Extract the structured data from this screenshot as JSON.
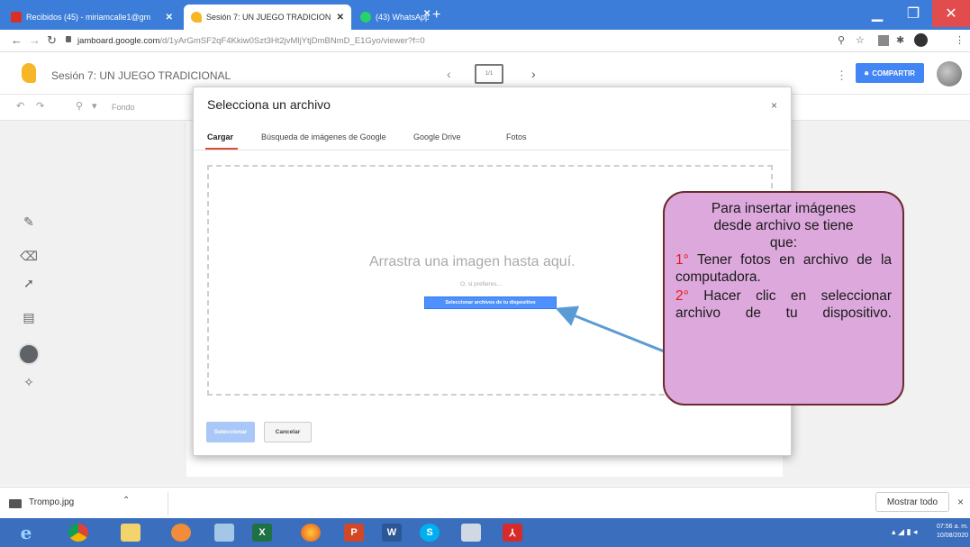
{
  "browser": {
    "tabs": [
      {
        "title": "Recibidos (45) - miriamcalle1@gm",
        "active": false,
        "favicon_color": "#d93025"
      },
      {
        "title": "Sesión 7: UN JUEGO TRADICION",
        "active": true,
        "favicon_color": "#f6b625"
      },
      {
        "title": "(43) WhatsApp",
        "active": false,
        "favicon_color": "#25d366"
      }
    ],
    "new_tab": "+",
    "url_host": "jamboard.google.com",
    "url_path": "/d/1yArGmSF2qF4Kkiw0Szt3Ht2jvMljYtjDmBNmD_E1Gyo/viewer?f=0"
  },
  "jamboard": {
    "title": "Sesión 7: UN JUEGO TRADICIONAL",
    "frame_indicator": "1/1",
    "share_label": "COMPARTIR",
    "toolbar_background": "Fondo"
  },
  "dialog": {
    "title": "Selecciona un archivo",
    "close": "×",
    "tabs": [
      "Cargar",
      "Búsqueda de imágenes de Google",
      "Google Drive",
      "Fotos"
    ],
    "drop_text": "Arrastra una imagen hasta aquí.",
    "or_text": "O, si prefieres...",
    "select_device_button": "Seleccionar archivos de tu dispositivo",
    "select_button": "Seleccionar",
    "cancel_button": "Cancelar"
  },
  "callout": {
    "line1": "Para insertar imágenes",
    "line2": "desde archivo se tiene",
    "line3": "que:",
    "step1_num": "1°",
    "step1_text": "Tener fotos en archivo de la computadora.",
    "step2_num": "2°",
    "step2_text": "Hacer clic en seleccionar archivo de tu dispositivo."
  },
  "downloads": {
    "file_name": "Trompo.jpg",
    "show_all": "Mostrar todo",
    "close": "×"
  },
  "taskbar": {
    "clock_time": "07:56 a. m.",
    "clock_date": "10/08/2020"
  },
  "colors": {
    "chrome_blue": "#3c7dd9",
    "share_blue": "#4285f4",
    "callout_fill": "#dda9dd",
    "callout_border": "#6b2c2c",
    "step_number_red": "#e81818",
    "taskbar_blue": "#3b6ebd"
  }
}
